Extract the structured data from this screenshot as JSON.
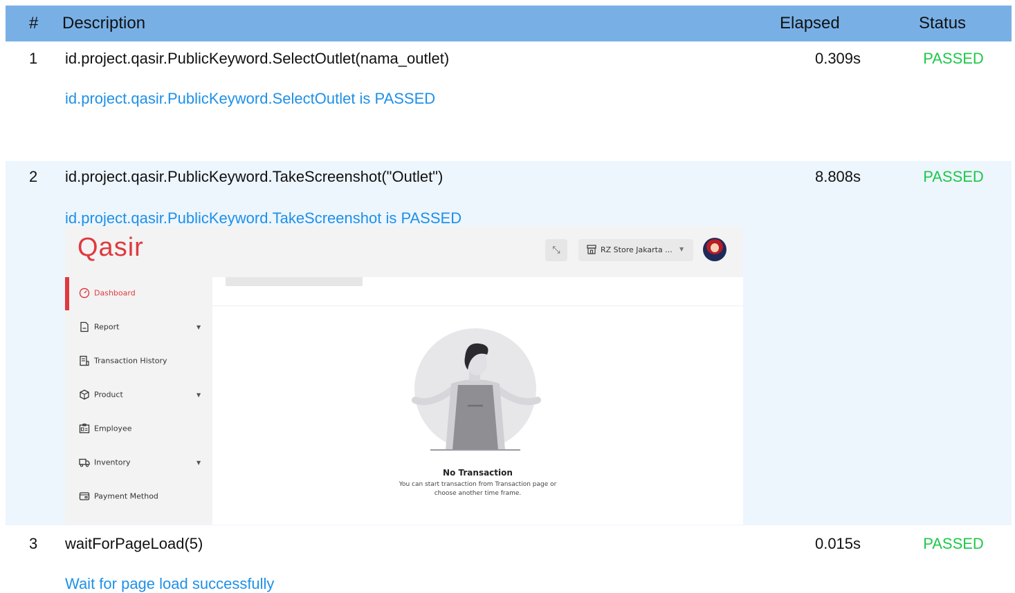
{
  "table": {
    "headers": {
      "num": "#",
      "description": "Description",
      "elapsed": "Elapsed",
      "status": "Status"
    },
    "rows": [
      {
        "num": "1",
        "description": "id.project.qasir.PublicKeyword.SelectOutlet(nama_outlet)",
        "elapsed": "0.309s",
        "status": "PASSED",
        "message": "id.project.qasir.PublicKeyword.SelectOutlet is PASSED"
      },
      {
        "num": "2",
        "description": "id.project.qasir.PublicKeyword.TakeScreenshot(\"Outlet\")",
        "elapsed": "8.808s",
        "status": "PASSED",
        "message": "id.project.qasir.PublicKeyword.TakeScreenshot is PASSED"
      },
      {
        "num": "3",
        "description": "waitForPageLoad(5)",
        "elapsed": "0.015s",
        "status": "PASSED",
        "message": "Wait for page load successfully"
      }
    ]
  },
  "colors": {
    "header_bg": "#78b0e6",
    "passed": "#1ec84a",
    "message": "#1e90e8",
    "brand": "#e0393e",
    "alt_row": "#edf5fd"
  },
  "screenshot": {
    "logo": "Qasir",
    "outlet_label": "RZ Store Jakarta ...",
    "icons": {
      "expand": "expand-icon",
      "outlet": "store-icon",
      "caret": "chevron-down-icon"
    },
    "sidebar": [
      {
        "label": "Dashboard",
        "icon": "dashboard-icon",
        "active": true,
        "expandable": false
      },
      {
        "label": "Report",
        "icon": "report-icon",
        "active": false,
        "expandable": true
      },
      {
        "label": "Transaction History",
        "icon": "transaction-history-icon",
        "active": false,
        "expandable": false
      },
      {
        "label": "Product",
        "icon": "product-icon",
        "active": false,
        "expandable": true
      },
      {
        "label": "Employee",
        "icon": "employee-icon",
        "active": false,
        "expandable": false
      },
      {
        "label": "Inventory",
        "icon": "inventory-icon",
        "active": false,
        "expandable": true
      },
      {
        "label": "Payment Method",
        "icon": "payment-method-icon",
        "active": false,
        "expandable": false
      }
    ],
    "empty_state": {
      "title": "No Transaction",
      "subtitle_line1": "You can start transaction from Transaction page or",
      "subtitle_line2": "choose another time frame."
    }
  }
}
